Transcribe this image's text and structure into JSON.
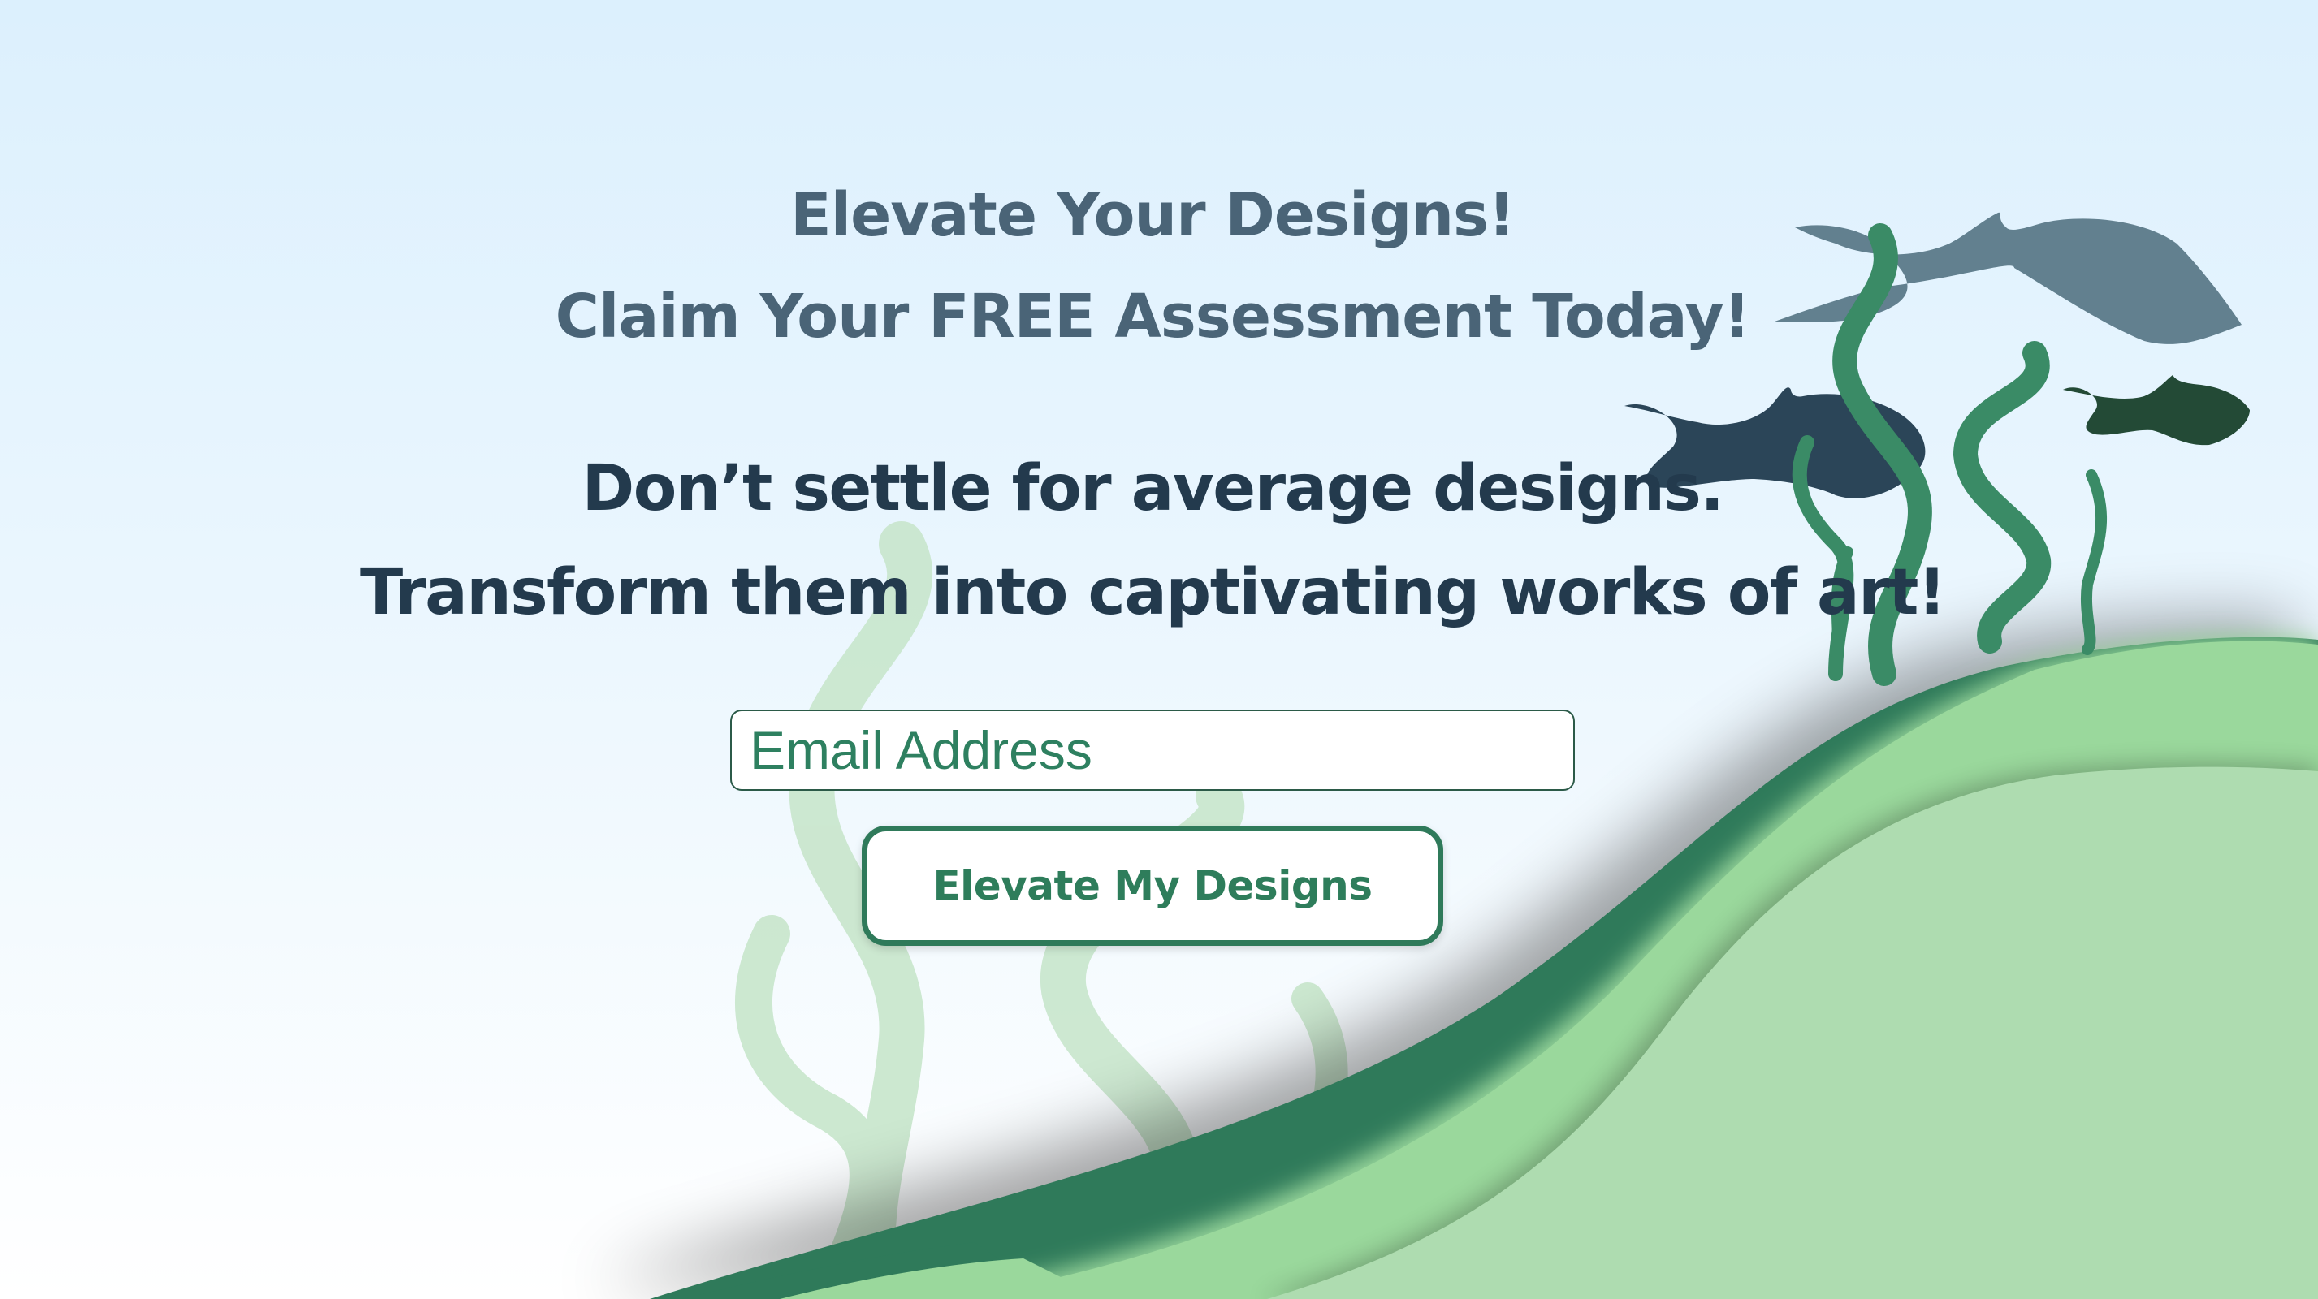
{
  "header": {
    "line1": "Elevate Your Designs!",
    "line2": "Claim Your FREE Assessment Today!"
  },
  "pitch": {
    "line1": "Don’t settle for average designs.",
    "line2": "Transform them into captivating works of art!"
  },
  "form": {
    "email_placeholder": "Email Address",
    "submit_label": "Elevate My Designs"
  },
  "colors": {
    "sky_top": "#dcf0fd",
    "headline": "#4a6477",
    "pitch_text": "#233a4d",
    "accent_green": "#2e7d5b",
    "hill_dark": "#2f7a5a",
    "hill_light": "#aedcb0"
  },
  "decor": {
    "fish_icons": [
      "fish-icon",
      "fish-icon",
      "fish-icon"
    ],
    "seaweed_icons": [
      "seaweed-icon"
    ]
  }
}
